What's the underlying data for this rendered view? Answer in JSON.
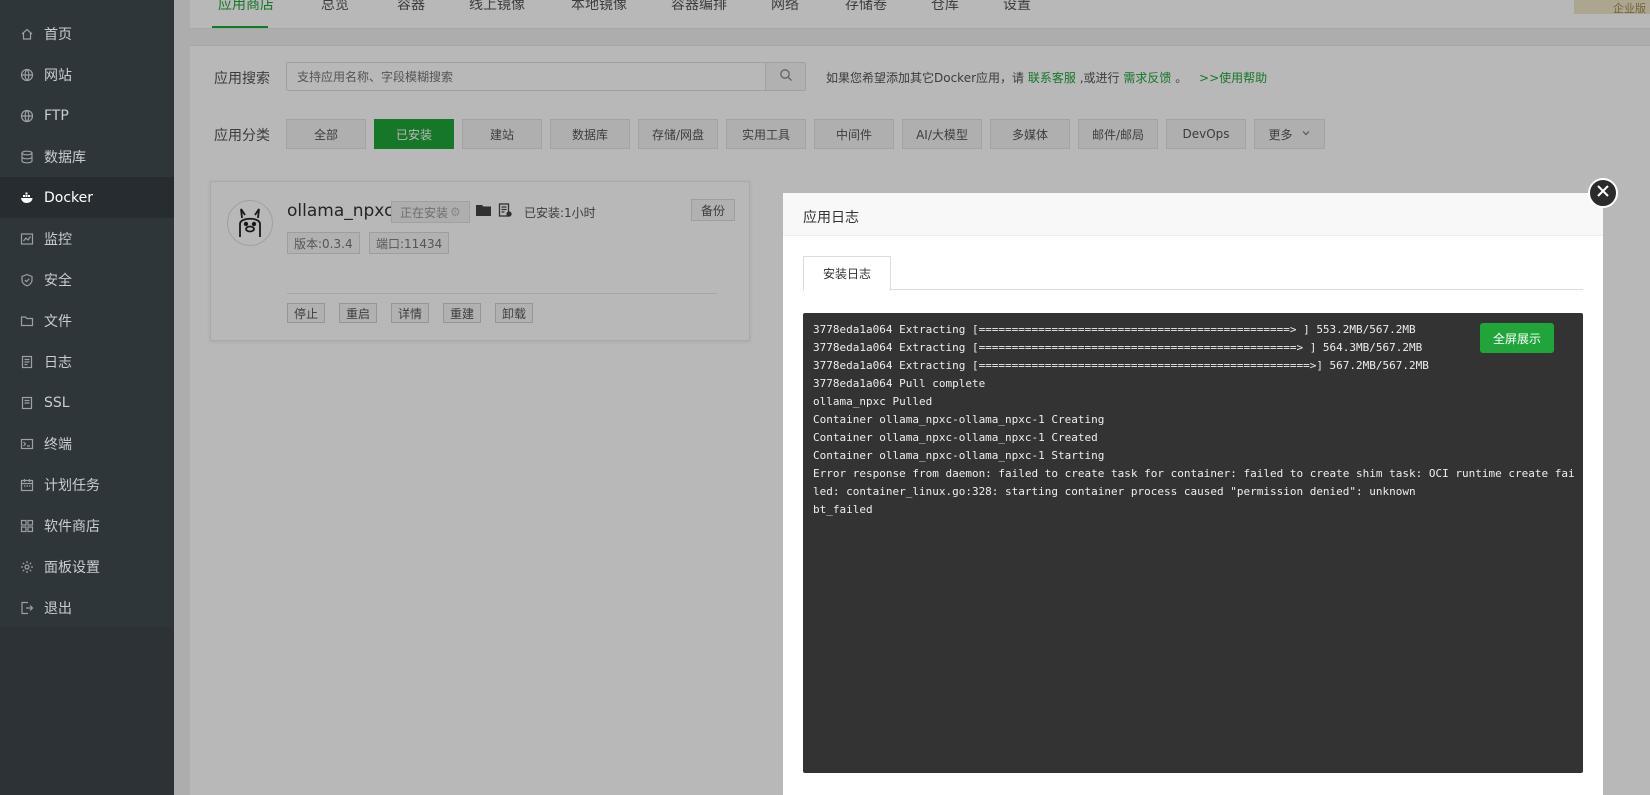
{
  "sidebar": {
    "items": [
      {
        "label": "首页",
        "icon": "home-icon"
      },
      {
        "label": "网站",
        "icon": "globe-icon"
      },
      {
        "label": "FTP",
        "icon": "globe-icon"
      },
      {
        "label": "数据库",
        "icon": "database-icon"
      },
      {
        "label": "Docker",
        "icon": "docker-icon",
        "active": true
      },
      {
        "label": "监控",
        "icon": "monitor-icon"
      },
      {
        "label": "安全",
        "icon": "shield-icon"
      },
      {
        "label": "文件",
        "icon": "folder-icon"
      },
      {
        "label": "日志",
        "icon": "log-icon"
      },
      {
        "label": "SSL",
        "icon": "ssl-icon"
      },
      {
        "label": "终端",
        "icon": "terminal-icon"
      },
      {
        "label": "计划任务",
        "icon": "calendar-icon"
      },
      {
        "label": "软件商店",
        "icon": "grid-icon"
      },
      {
        "label": "面板设置",
        "icon": "gear-icon"
      },
      {
        "label": "退出",
        "icon": "logout-icon"
      }
    ]
  },
  "topnav": {
    "tabs": [
      "应用商店",
      "总览",
      "容器",
      "线上镜像",
      "本地镜像",
      "容器编排",
      "网络",
      "存储卷",
      "仓库",
      "设置"
    ],
    "active": "应用商店",
    "badge": "企业版"
  },
  "search": {
    "label": "应用搜索",
    "placeholder": "支持应用名称、字段模糊搜索",
    "hint_prefix": "如果您希望添加其它Docker应用，请",
    "hint_link1": "联系客服",
    "hint_mid": ",或进行",
    "hint_link2": "需求反馈",
    "hint_suffix": "。",
    "hint_help": ">>使用帮助"
  },
  "categories": {
    "label": "应用分类",
    "items": [
      "全部",
      "已安装",
      "建站",
      "数据库",
      "存储/网盘",
      "实用工具",
      "中间件",
      "AI/大模型",
      "多媒体",
      "邮件/邮局",
      "DevOps",
      "更多"
    ],
    "active": "已安装"
  },
  "app_card": {
    "name": "ollama_npxc",
    "status": "正在安装",
    "installed": "已安装:1小时",
    "backup": "备份",
    "version": "版本:0.3.4",
    "port": "端口:11434",
    "actions": [
      "停止",
      "重启",
      "详情",
      "重建",
      "卸载"
    ]
  },
  "modal": {
    "title": "应用日志",
    "tab": "安装日志",
    "fullscreen": "全屏展示",
    "log_lines": [
      "3778eda1a064 Extracting [===============================================> ] 553.2MB/567.2MB",
      "3778eda1a064 Extracting [================================================> ] 564.3MB/567.2MB",
      "3778eda1a064 Extracting [==================================================>] 567.2MB/567.2MB",
      "3778eda1a064 Pull complete",
      "ollama_npxc Pulled",
      "Container ollama_npxc-ollama_npxc-1 Creating",
      "Container ollama_npxc-ollama_npxc-1 Created",
      "Container ollama_npxc-ollama_npxc-1 Starting",
      "Error response from daemon: failed to create task for container: failed to create shim task: OCI runtime create fai",
      "led: container_linux.go:328: starting container process caused \"permission denied\": unknown",
      "bt_failed"
    ]
  },
  "colors": {
    "accent": "#20a53a",
    "sidebar": "#2f363a",
    "log_bg": "#333333"
  }
}
